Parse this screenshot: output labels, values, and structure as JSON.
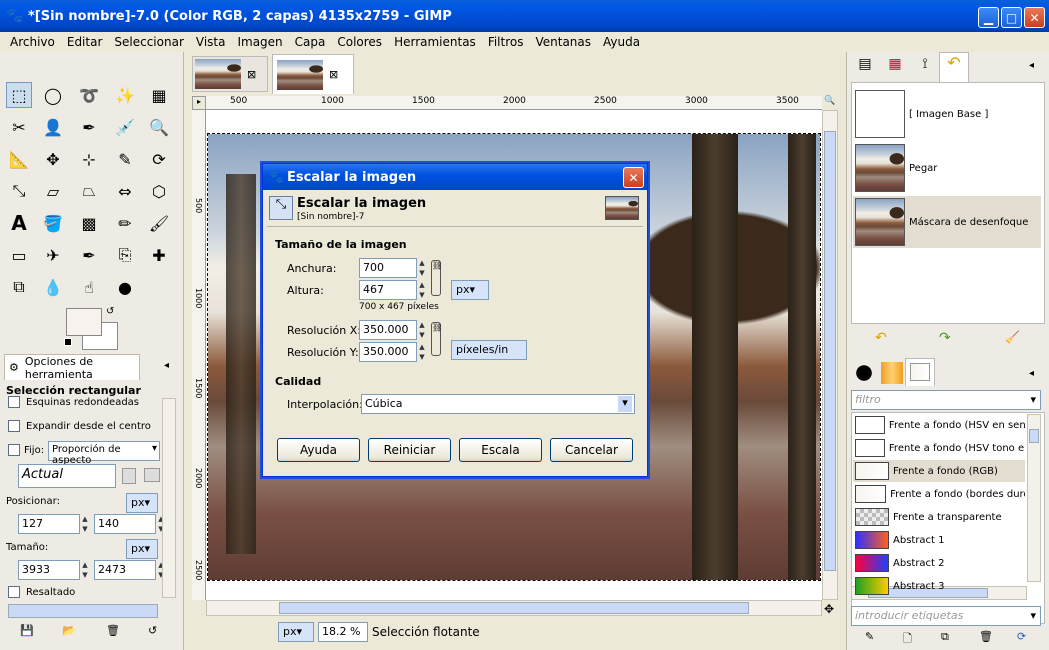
{
  "window": {
    "title": "*[Sin nombre]-7.0 (Color RGB, 2 capas) 4135x2759 - GIMP"
  },
  "menu": [
    "Archivo",
    "Editar",
    "Seleccionar",
    "Vista",
    "Imagen",
    "Capa",
    "Colores",
    "Herramientas",
    "Filtros",
    "Ventanas",
    "Ayuda"
  ],
  "toolbox": {
    "tab_label": "Opciones de herramienta",
    "tool_title": "Selección rectangular",
    "rounded_corners": "Esquinas redondeadas",
    "expand_center": "Expandir desde el centro",
    "fixed_label": "Fijo:",
    "fixed_value": "Proporción de aspecto",
    "current_value": "Actual",
    "position_label": "Posicionar:",
    "position_unit": "px",
    "pos_x": "127",
    "pos_y": "140",
    "size_label": "Tamaño:",
    "size_unit": "px",
    "size_w": "3933",
    "size_h": "2473",
    "highlight": "Resaltado"
  },
  "ruler": {
    "ticks": [
      "500",
      "1000",
      "1500",
      "2000",
      "2500",
      "3000",
      "3500"
    ],
    "vticks": [
      "500",
      "1000",
      "1500",
      "2000",
      "2500"
    ]
  },
  "status": {
    "unit": "px",
    "zoom": "18.2 %",
    "message": "Selección flotante"
  },
  "dialog": {
    "title": "Escalar la imagen",
    "header": "Escalar la imagen",
    "subheader": "[Sin nombre]-7",
    "size_section": "Tamaño de la imagen",
    "width_label": "Anchura:",
    "width_value": "700",
    "height_label": "Altura:",
    "height_value": "467",
    "unit": "px",
    "pixels_info": "700 x 467 píxeles",
    "res_x_label": "Resolución X:",
    "res_x_value": "350.000",
    "res_y_label": "Resolución Y:",
    "res_y_value": "350.000",
    "res_unit": "píxeles/in",
    "quality_section": "Calidad",
    "interp_label": "Interpolación:",
    "interp_value": "Cúbica",
    "btn_help": "Ayuda",
    "btn_reset": "Reiniciar",
    "btn_scale": "Escala",
    "btn_cancel": "Cancelar"
  },
  "layers": [
    {
      "name": "[ Imagen Base ]"
    },
    {
      "name": "Pegar"
    },
    {
      "name": "Máscara de desenfoque"
    }
  ],
  "gradients": {
    "filter_placeholder": "filtro",
    "tags_placeholder": "introducir etiquetas",
    "items": [
      {
        "name": "Frente a fondo (HSV en sentido",
        "colors": [
          "#ffffff",
          "#ffffff"
        ]
      },
      {
        "name": "Frente a fondo (HSV tono en se",
        "colors": [
          "#ffffff",
          "#ffffff"
        ]
      },
      {
        "name": "Frente a fondo (RGB)",
        "colors": [
          "#f8f4ee",
          "#ffffff"
        ]
      },
      {
        "name": "Frente a fondo (bordes duros)",
        "colors": [
          "#f8f4ee",
          "#ffffff"
        ]
      },
      {
        "name": "Frente a transparente",
        "colors": [
          "#bbbbbb",
          "#eeeeee"
        ]
      },
      {
        "name": "Abstract 1",
        "colors": [
          "#3030ff",
          "#ff6020"
        ]
      },
      {
        "name": "Abstract 2",
        "colors": [
          "#ff0040",
          "#2040ff"
        ]
      },
      {
        "name": "Abstract 3",
        "colors": [
          "#20a020",
          "#ffcc00"
        ]
      }
    ]
  }
}
